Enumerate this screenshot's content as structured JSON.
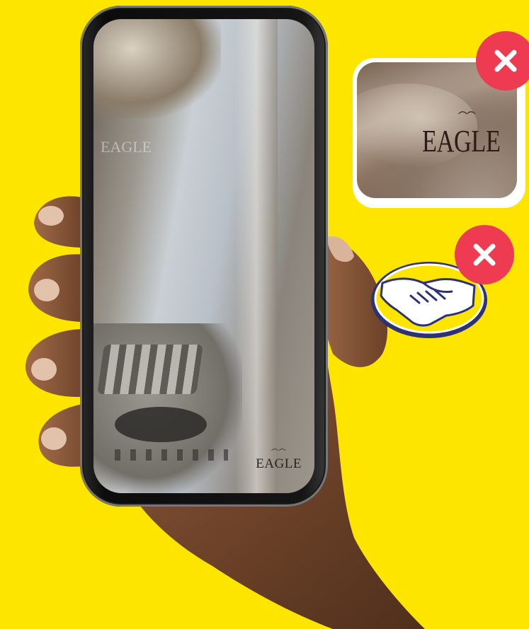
{
  "screen": {
    "logo_text": "EAGLE",
    "ghost_logo_text": "EAGLE"
  },
  "zoom_card": {
    "logo_text": "EAGLE"
  },
  "badges": [
    {
      "icon": "close-icon",
      "color": "#EF3B52"
    },
    {
      "icon": "close-icon",
      "color": "#EF3B52"
    }
  ],
  "marketplace_logo": {
    "icon": "handshake-icon",
    "colors": {
      "fill": "#FDE500",
      "outline": "#2D3277"
    }
  },
  "colors": {
    "background": "#FDE500",
    "alert": "#EF3B52",
    "logo_outline": "#2D3277"
  }
}
